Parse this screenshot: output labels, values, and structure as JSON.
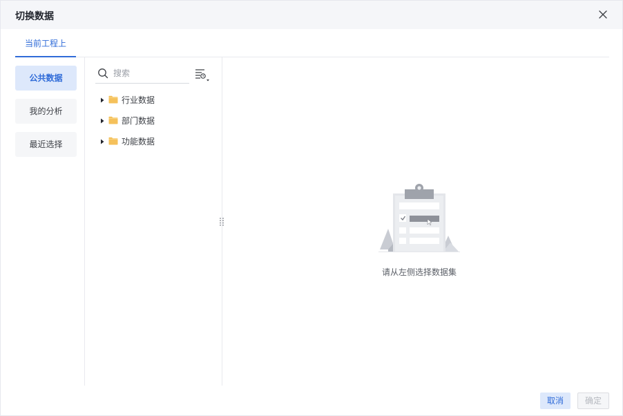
{
  "dialog": {
    "title": "切换数据"
  },
  "tabs": [
    {
      "label": "当前工程上",
      "active": true
    }
  ],
  "left_nav": {
    "items": [
      {
        "label": "公共数据",
        "active": true
      },
      {
        "label": "我的分析",
        "active": false
      },
      {
        "label": "最近选择",
        "active": false
      }
    ]
  },
  "search": {
    "placeholder": "搜索",
    "value": ""
  },
  "tree": {
    "nodes": [
      {
        "label": "行业数据",
        "icon": "folder-icon",
        "expanded": false
      },
      {
        "label": "部门数据",
        "icon": "folder-icon",
        "expanded": false
      },
      {
        "label": "功能数据",
        "icon": "folder-icon",
        "expanded": false
      }
    ]
  },
  "empty_state": {
    "message": "请从左侧选择数据集",
    "icon": "clipboard-illustration"
  },
  "footer": {
    "cancel_label": "取消",
    "ok_label": "确定",
    "ok_disabled": true
  },
  "colors": {
    "accent": "#2f6bd8",
    "accent_light": "#dde8fb",
    "header_bg": "#f5f6f9",
    "folder": "#f5c15b"
  }
}
